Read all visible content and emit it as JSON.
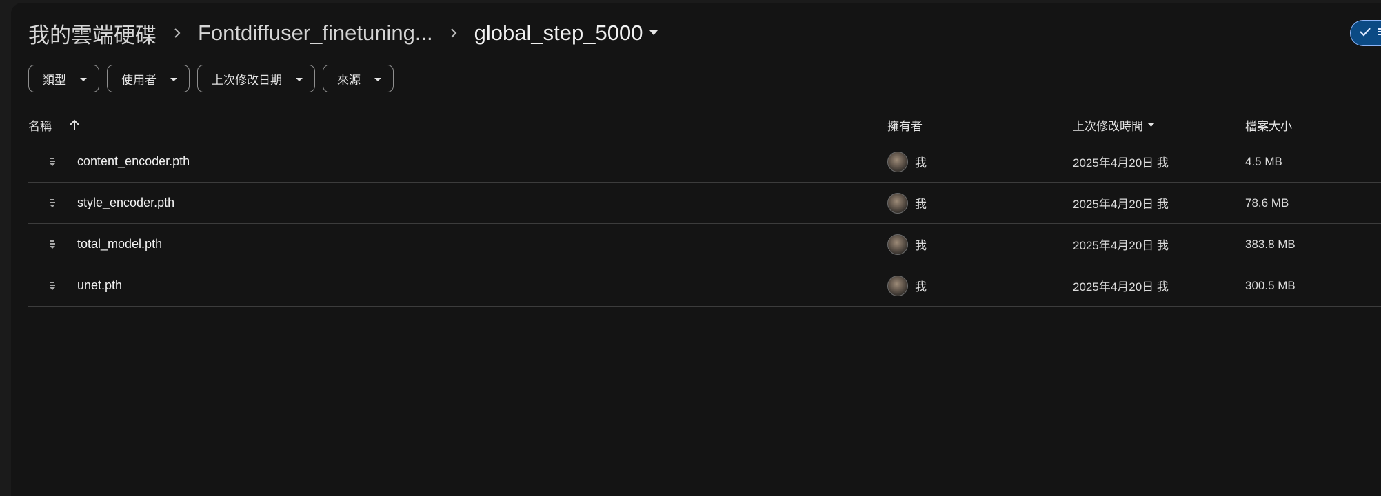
{
  "breadcrumb": {
    "root": "我的雲端硬碟",
    "parent": "Fontdiffuser_finetuning...",
    "current": "global_step_5000"
  },
  "filters": [
    {
      "label": "類型"
    },
    {
      "label": "使用者"
    },
    {
      "label": "上次修改日期"
    },
    {
      "label": "來源"
    }
  ],
  "columns": {
    "name": "名稱",
    "owner": "擁有者",
    "modified": "上次修改時間",
    "size": "檔案大小"
  },
  "files": [
    {
      "name": "content_encoder.pth",
      "owner": "我",
      "modified": "2025年4月20日 我",
      "size": "4.5 MB",
      "icon": "file-icon"
    },
    {
      "name": "style_encoder.pth",
      "owner": "我",
      "modified": "2025年4月20日 我",
      "size": "78.6 MB",
      "icon": "file-icon"
    },
    {
      "name": "total_model.pth",
      "owner": "我",
      "modified": "2025年4月20日 我",
      "size": "383.8 MB",
      "icon": "file-icon"
    },
    {
      "name": "unet.pth",
      "owner": "我",
      "modified": "2025年4月20日 我",
      "size": "300.5 MB",
      "icon": "file-icon"
    }
  ],
  "colors": {
    "background": "#141414",
    "accent": "#0b4a84",
    "divider": "#3c3c3c"
  }
}
